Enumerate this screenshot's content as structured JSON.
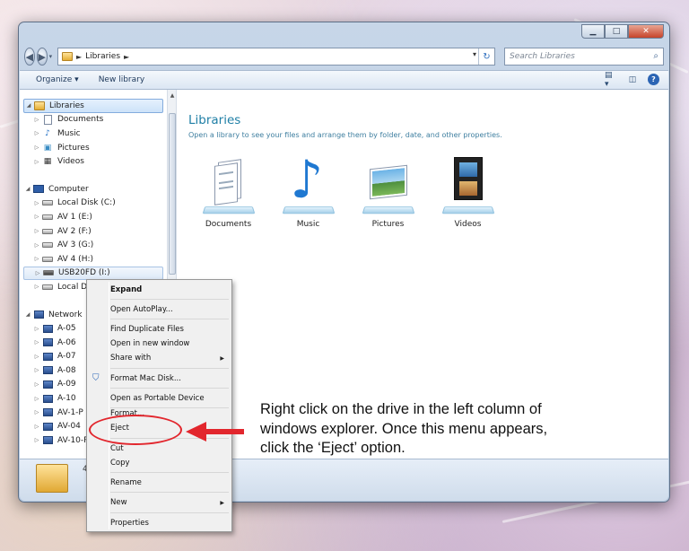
{
  "window": {
    "caption_minimize": "▁",
    "caption_maximize": "□",
    "caption_close": "✕"
  },
  "address_bar": {
    "back_icon": "arrow-left-icon",
    "forward_icon": "arrow-right-icon",
    "path": "Libraries",
    "path_separator": "►",
    "search_placeholder": "Search Libraries"
  },
  "toolbar": {
    "organize": "Organize ▾",
    "new_library": "New library"
  },
  "nav": {
    "libraries": {
      "label": "Libraries",
      "children": [
        "Documents",
        "Music",
        "Pictures",
        "Videos"
      ]
    },
    "computer": {
      "label": "Computer",
      "children": [
        "Local Disk (C:)",
        "AV 1 (E:)",
        "AV 2 (F:)",
        "AV 3 (G:)",
        "AV 4 (H:)",
        "USB20FD (I:)",
        "Local Di"
      ]
    },
    "network": {
      "label": "Network",
      "children": [
        "A-05",
        "A-06",
        "A-07",
        "A-08",
        "A-09",
        "A-10",
        "AV-1-P",
        "AV-04",
        "AV-10-R"
      ]
    }
  },
  "main": {
    "title": "Libraries",
    "subtitle": "Open a library to see your files and arrange them by folder, date, and other properties.",
    "tiles": [
      "Documents",
      "Music",
      "Pictures",
      "Videos"
    ]
  },
  "details": {
    "count": "4"
  },
  "context_menu": {
    "expand": "Expand",
    "open_autoplay": "Open AutoPlay...",
    "find_duplicates": "Find Duplicate Files",
    "open_new_window": "Open in new window",
    "share_with": "Share with",
    "format_mac": "Format Mac Disk...",
    "open_portable": "Open as Portable Device",
    "format": "Format...",
    "eject": "Eject",
    "cut": "Cut",
    "copy": "Copy",
    "rename": "Rename",
    "new": "New",
    "properties": "Properties"
  },
  "annotation": {
    "text": "Right click on the drive in the left column of windows explorer. Once this menu appears, click the ‘Eject’ option.",
    "accent_color": "#e2262d"
  }
}
